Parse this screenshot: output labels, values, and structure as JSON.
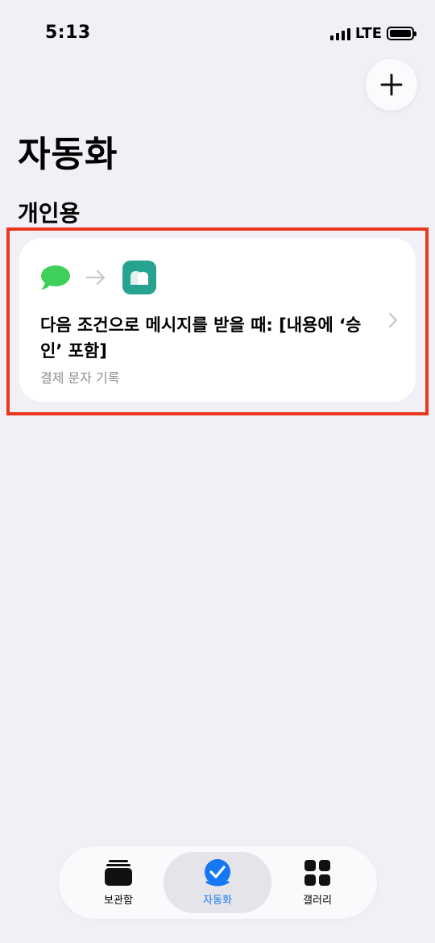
{
  "status_bar": {
    "time": "5:13",
    "network": "LTE"
  },
  "header": {
    "title": "자동화",
    "add_icon": "plus-icon"
  },
  "section": {
    "title": "개인용"
  },
  "automation_card": {
    "trigger_icon": "messages-icon",
    "arrow_icon": "arrow-right-icon",
    "action_icon": "app-icon",
    "title": "다음 조건으로 메시지를 받을 때: [내용에 ‘승인’ 포함]",
    "subtitle": "결제 문자 기록",
    "highlight_color": "#e8361f"
  },
  "tabbar": {
    "tabs": [
      {
        "label": "보관함",
        "icon": "library-icon",
        "active": false
      },
      {
        "label": "자동화",
        "icon": "automation-check-icon",
        "active": true
      },
      {
        "label": "갤러리",
        "icon": "gallery-grid-icon",
        "active": false
      }
    ]
  },
  "colors": {
    "accent": "#1677f2",
    "app_icon_bg": "#25a38f",
    "messages_green": "#3fd05a"
  }
}
